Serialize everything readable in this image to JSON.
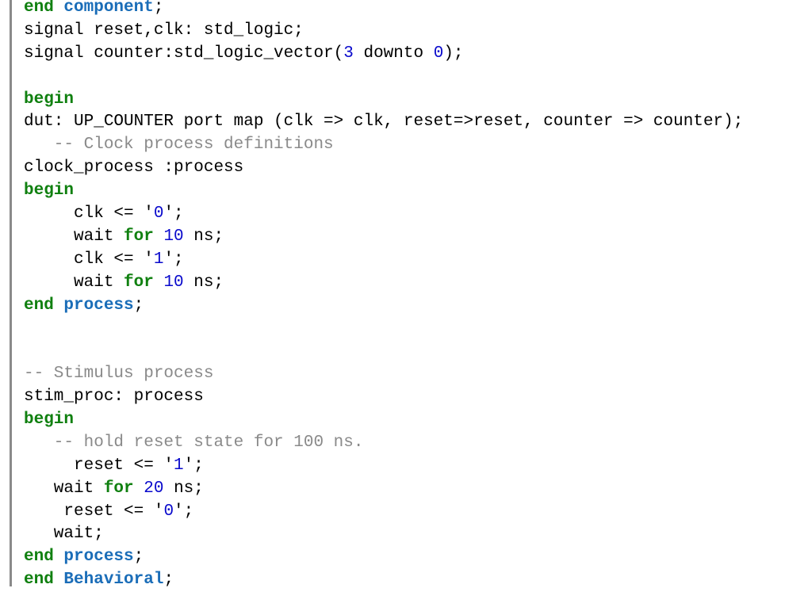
{
  "editor": {
    "language": "VHDL",
    "colors": {
      "keyword_green": "#108010",
      "keyword_blue": "#1a6db8",
      "number": "#0a0acc",
      "comment": "#8a8a8a",
      "text": "#000000",
      "gutter_bar": "#8a8a8a"
    },
    "lines": [
      [
        {
          "t": "kw",
          "v": "end"
        },
        {
          "t": "pl",
          "v": " "
        },
        {
          "t": "kw2",
          "v": "component"
        },
        {
          "t": "pl",
          "v": ";"
        }
      ],
      [
        {
          "t": "pl",
          "v": "signal reset,clk: std_logic;"
        }
      ],
      [
        {
          "t": "pl",
          "v": "signal counter:std_logic_vector("
        },
        {
          "t": "num",
          "v": "3"
        },
        {
          "t": "pl",
          "v": " downto "
        },
        {
          "t": "num",
          "v": "0"
        },
        {
          "t": "pl",
          "v": ");"
        }
      ],
      [],
      [
        {
          "t": "kw",
          "v": "begin"
        }
      ],
      [
        {
          "t": "pl",
          "v": "dut: UP_COUNTER port map (clk => clk, reset=>reset, counter => counter);"
        }
      ],
      [
        {
          "t": "cm",
          "v": "   -- Clock process definitions"
        }
      ],
      [
        {
          "t": "pl",
          "v": "clock_process :process"
        }
      ],
      [
        {
          "t": "kw",
          "v": "begin"
        }
      ],
      [
        {
          "t": "pl",
          "v": "     clk <= '"
        },
        {
          "t": "num",
          "v": "0"
        },
        {
          "t": "pl",
          "v": "';"
        }
      ],
      [
        {
          "t": "pl",
          "v": "     wait "
        },
        {
          "t": "kw3",
          "v": "for"
        },
        {
          "t": "pl",
          "v": " "
        },
        {
          "t": "num",
          "v": "10"
        },
        {
          "t": "pl",
          "v": " ns;"
        }
      ],
      [
        {
          "t": "pl",
          "v": "     clk <= '"
        },
        {
          "t": "num",
          "v": "1"
        },
        {
          "t": "pl",
          "v": "';"
        }
      ],
      [
        {
          "t": "pl",
          "v": "     wait "
        },
        {
          "t": "kw3",
          "v": "for"
        },
        {
          "t": "pl",
          "v": " "
        },
        {
          "t": "num",
          "v": "10"
        },
        {
          "t": "pl",
          "v": " ns;"
        }
      ],
      [
        {
          "t": "kw",
          "v": "end"
        },
        {
          "t": "pl",
          "v": " "
        },
        {
          "t": "kw2",
          "v": "process"
        },
        {
          "t": "pl",
          "v": ";"
        }
      ],
      [],
      [],
      [
        {
          "t": "cm",
          "v": "-- Stimulus process"
        }
      ],
      [
        {
          "t": "pl",
          "v": "stim_proc: process"
        }
      ],
      [
        {
          "t": "kw",
          "v": "begin"
        }
      ],
      [
        {
          "t": "cm",
          "v": "   -- hold reset state for 100 ns."
        }
      ],
      [
        {
          "t": "pl",
          "v": "     reset <= '"
        },
        {
          "t": "num",
          "v": "1"
        },
        {
          "t": "pl",
          "v": "';"
        }
      ],
      [
        {
          "t": "pl",
          "v": "   wait "
        },
        {
          "t": "kw3",
          "v": "for"
        },
        {
          "t": "pl",
          "v": " "
        },
        {
          "t": "num",
          "v": "20"
        },
        {
          "t": "pl",
          "v": " ns;"
        }
      ],
      [
        {
          "t": "pl",
          "v": "    reset <= '"
        },
        {
          "t": "num",
          "v": "0"
        },
        {
          "t": "pl",
          "v": "';"
        }
      ],
      [
        {
          "t": "pl",
          "v": "   wait;"
        }
      ],
      [
        {
          "t": "kw",
          "v": "end"
        },
        {
          "t": "pl",
          "v": " "
        },
        {
          "t": "kw2",
          "v": "process"
        },
        {
          "t": "pl",
          "v": ";"
        }
      ],
      [
        {
          "t": "kw",
          "v": "end"
        },
        {
          "t": "pl",
          "v": " "
        },
        {
          "t": "kw2",
          "v": "Behavioral"
        },
        {
          "t": "pl",
          "v": ";"
        }
      ]
    ]
  }
}
